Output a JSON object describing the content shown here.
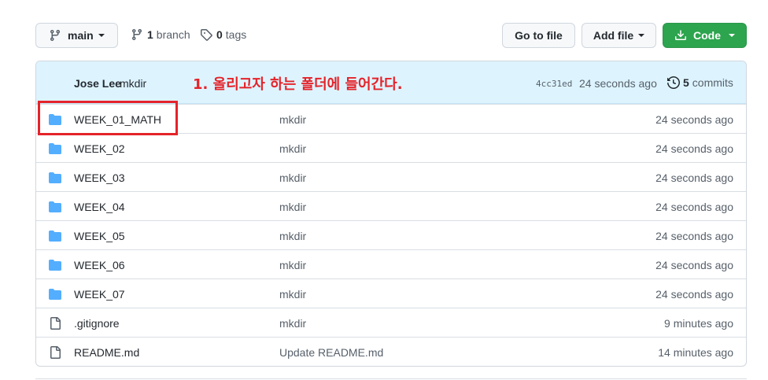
{
  "toolbar": {
    "branch_label": "main",
    "branch_count": "1",
    "branch_word": "branch",
    "tag_count": "0",
    "tag_word": "tags",
    "goto_file_label": "Go to file",
    "add_file_label": "Add file",
    "code_label": "Code"
  },
  "commit": {
    "author": "Jose Lee",
    "message": "mkdir",
    "sha": "4cc31ed",
    "age": "24 seconds ago",
    "commit_count": "5",
    "commits_word": "commits"
  },
  "annotation": {
    "text": "1. 올리고자 하는 폴더에 들어간다.",
    "color": "#e5232a"
  },
  "files": [
    {
      "type": "folder",
      "name": "WEEK_01_MATH",
      "message": "mkdir",
      "age": "24 seconds ago"
    },
    {
      "type": "folder",
      "name": "WEEK_02",
      "message": "mkdir",
      "age": "24 seconds ago"
    },
    {
      "type": "folder",
      "name": "WEEK_03",
      "message": "mkdir",
      "age": "24 seconds ago"
    },
    {
      "type": "folder",
      "name": "WEEK_04",
      "message": "mkdir",
      "age": "24 seconds ago"
    },
    {
      "type": "folder",
      "name": "WEEK_05",
      "message": "mkdir",
      "age": "24 seconds ago"
    },
    {
      "type": "folder",
      "name": "WEEK_06",
      "message": "mkdir",
      "age": "24 seconds ago"
    },
    {
      "type": "folder",
      "name": "WEEK_07",
      "message": "mkdir",
      "age": "24 seconds ago"
    },
    {
      "type": "file",
      "name": ".gitignore",
      "message": "mkdir",
      "age": "9 minutes ago"
    },
    {
      "type": "file",
      "name": "README.md",
      "message": "Update README.md",
      "age": "14 minutes ago"
    }
  ],
  "colors": {
    "folder_icon": "#54aeff",
    "code_button": "#2da44e",
    "header_bg": "#ddf4ff"
  }
}
